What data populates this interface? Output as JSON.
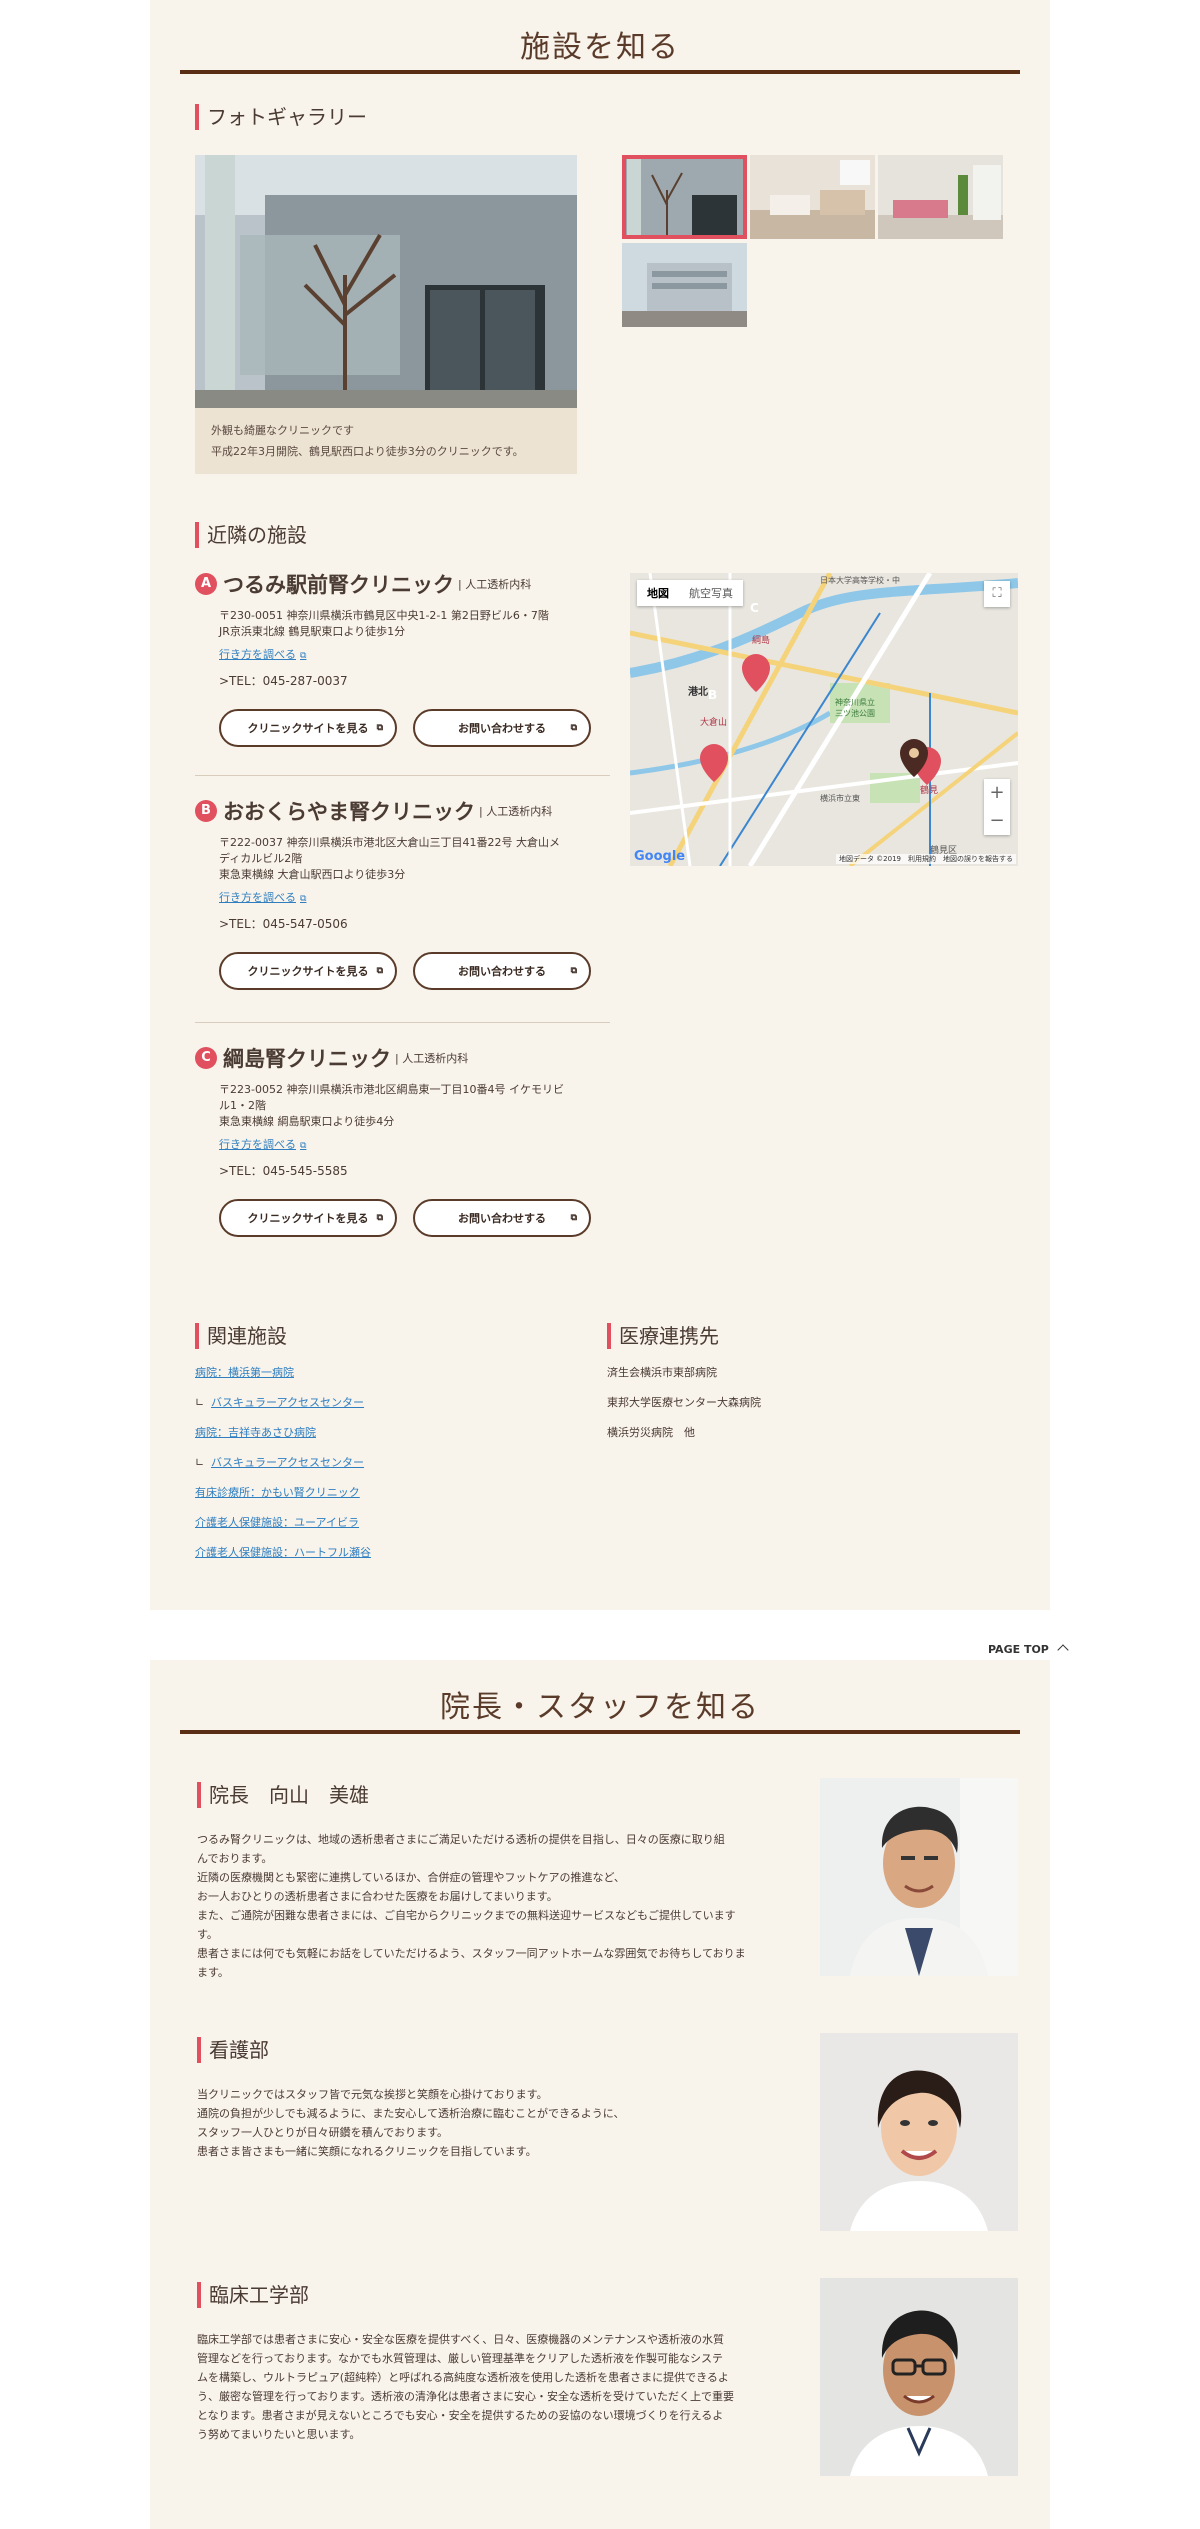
{
  "facility": {
    "title": "施設を知る",
    "gallery": {
      "heading": "フォトギャラリー",
      "caption_line1": "外観も綺麗なクリニックです",
      "caption_line2": "平成22年3月開院、鶴見駅西口より徒歩3分のクリニックです。"
    },
    "nearby": {
      "heading": "近隣の施設",
      "clinics": [
        {
          "badge": "A",
          "name": "つるみ駅前腎クリニック",
          "tag": "| 人工透析内科",
          "addr1": "〒230-0051 神奈川県横浜市鶴見区中央1-2-1 第2日野ビル6・7階",
          "addr2": "JR京浜東北線 鶴見駅東口より徒歩1分",
          "addr3": "",
          "route": "行き方を調べる",
          "tel": ">TEL：045-287-0037",
          "site_btn": "クリニックサイトを見る",
          "contact_btn": "お問い合わせする"
        },
        {
          "badge": "B",
          "name": "おおくらやま腎クリニック",
          "tag": "| 人工透析内科",
          "addr1": "〒222-0037 神奈川県横浜市港北区大倉山三丁目41番22号 大倉山メ",
          "addr2": "ディカルビル2階",
          "addr3": "東急東横線 大倉山駅西口より徒歩3分",
          "route": "行き方を調べる",
          "tel": ">TEL：045-547-0506",
          "site_btn": "クリニックサイトを見る",
          "contact_btn": "お問い合わせする"
        },
        {
          "badge": "C",
          "name": "綱島腎クリニック",
          "tag": "| 人工透析内科",
          "addr1": "〒223-0052 神奈川県横浜市港北区綱島東一丁目10番4号 イケモリビ",
          "addr2": "ル1・2階",
          "addr3": "東急東横線 綱島駅東口より徒歩4分",
          "route": "行き方を調べる",
          "tel": ">TEL：045-545-5585",
          "site_btn": "クリニックサイトを見る",
          "contact_btn": "お問い合わせする"
        }
      ]
    },
    "map": {
      "tab_map": "地図",
      "tab_aerial": "航空写真",
      "zoom_in": "+",
      "zoom_out": "−",
      "attribution": "地図データ ©2019　利用規約　地図の誤りを報告する",
      "brand": "Google",
      "labels": {
        "kohoku": "港北",
        "tsurumi": "鶴見区",
        "okurayama": "大倉山",
        "tsunashima": "綱島",
        "tsurumi_stn": "鶴見",
        "univ": "日本大学高等学校・中",
        "park": "神奈川県立\n三ツ池公園",
        "hospital": "横浜市立東"
      }
    },
    "related": {
      "heading": "関連施設",
      "links": [
        {
          "text": "病院：横浜第一病院",
          "child": false
        },
        {
          "text": "バスキュラーアクセスセンター",
          "child": true
        },
        {
          "text": "病院：吉祥寺あさひ病院",
          "child": false
        },
        {
          "text": "バスキュラーアクセスセンター",
          "child": true
        },
        {
          "text": "有床診療所：かもい腎クリニック",
          "child": false
        },
        {
          "text": "介護老人保健施設：ユーアイビラ",
          "child": false
        },
        {
          "text": "介護老人保健施設：ハートフル瀬谷",
          "child": false
        }
      ]
    },
    "medical": {
      "heading": "医療連携先",
      "items": [
        "済生会横浜市東部病院",
        "東邦大学医療センター大森病院",
        "横浜労災病院　他"
      ]
    }
  },
  "page_top": "PAGE TOP",
  "staff": {
    "title": "院長・スタッフを知る",
    "director": {
      "heading": "院長　向山　美雄",
      "lines": [
        "つるみ腎クリニックは、地域の透析患者さまにご満足いただける透析の提供を目指し、日々の医療に取り組",
        "んでおります。",
        "近隣の医療機関とも緊密に連携しているほか、合併症の管理やフットケアの推進など、",
        "お一人おひとりの透析患者さまに合わせた医療をお届けしてまいります。",
        "また、ご通院が困難な患者さまには、ご自宅からクリニックまでの無料送迎サービスなどもご提供しています",
        "す。",
        "患者さまには何でも気軽にお話をしていただけるよう、スタッフ一同アットホームな雰囲気でお待ちしておりま",
        "ます。"
      ]
    },
    "nursing": {
      "heading": "看護部",
      "lines": [
        "当クリニックではスタッフ皆で元気な挨拶と笑顔を心掛けております。",
        "通院の負担が少しでも減るように、また安心して透析治療に臨むことができるように、",
        "スタッフ一人ひとりが日々研鑽を積んでおります。",
        "患者さま皆さまも一緒に笑顔になれるクリニックを目指しています。"
      ]
    },
    "clinical": {
      "heading": "臨床工学部",
      "lines": [
        "臨床工学部では患者さまに安心・安全な医療を提供すべく、日々、医療機器のメンテナンスや透析液の水質",
        "管理などを行っております。なかでも水質管理は、厳しい管理基準をクリアした透析液を作製可能なシステ",
        "ムを構築し、ウルトラピュア(超純粋）と呼ばれる高純度な透析液を使用した透析を患者さまに提供できるよ",
        "う、厳密な管理を行っております。透析液の清浄化は患者さまに安心・安全な透析を受けていただく上で重要",
        "となります。患者さまが見えないところでも安心・安全を提供するための妥協のない環境づくりを行えるよ",
        "う努めてまいりたいと思います。"
      ]
    }
  }
}
